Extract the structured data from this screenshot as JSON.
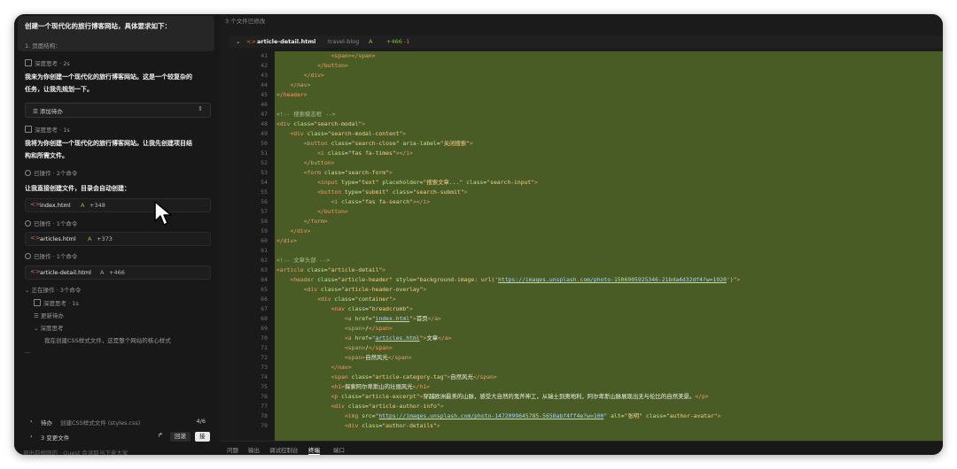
{
  "chat": {
    "prompt": "创建一个现代化的旅行博客网站，具体要求如下：",
    "prompt_sub": "1. 页面结构：",
    "thinking_1_label": "深度思考 · 2s",
    "reply_1": "我来为你创建一个现代化的旅行博客网站。这是一个较复杂的",
    "reply_1b": "任务，让我先规划一下。",
    "todo_label": "添加待办",
    "thinking_2_label": "深度思考 · 1s",
    "reply_2": "我将为你创建一个现代化的旅行博客网站。让我先创建项目结",
    "reply_2b": "构和所需文件。",
    "done_ops_1": "已操作 · 2个命令",
    "intro_create": "让我直接创建文件，目录会自动创建：",
    "files": [
      {
        "name": "index.html",
        "status": "A",
        "count": "+348"
      },
      {
        "name": "articles.html",
        "status": "A",
        "count": "+373"
      },
      {
        "name": "article-detail.html",
        "status": "A",
        "count": "+466"
      }
    ],
    "done_ops_2": "已操作 · 1个命令",
    "done_ops_3": "已操作 · 1个命令",
    "done_ops_4": "已操作 · 1个命令",
    "in_progress": "正在操作 · 3个命令",
    "sub_thinking": "深度思考 · 1s",
    "update_todo": "更新待办",
    "deep_thinking": "深度思考",
    "deep_thinking_detail": "我在创建CSS样式文件，这是整个网站的核心样式",
    "todo_row_label": "待办",
    "todo_row_detail": "创建CSS样式文件 (styles.css)",
    "todo_row_count": "4/6",
    "changes_label": "3 变更文件",
    "btn_revert": "回滚",
    "btn_accept": "接受",
    "input_hint": "退出前规则的 · Quest 会读取当下来大家"
  },
  "editor": {
    "changed_label": "3 个文件已修改",
    "file_name": "article-detail.html",
    "file_dir": "travel-blog",
    "file_status": "A",
    "file_added": "+466",
    "file_removed": "-1",
    "line_start": 41,
    "lines": [
      "                <span></span>",
      "            </button>",
      "        </div>",
      "    </nav>",
      "</header>",
      "",
      "<!-- 搜索模态框 -->",
      "<div class=\"search-modal\">",
      "    <div class=\"search-modal-content\">",
      "        <button class=\"search-close\" aria-label=\"关闭搜索\">",
      "            <i class=\"fas fa-times\"></i>",
      "        </button>",
      "        <form class=\"search-form\">",
      "            <input type=\"text\" placeholder=\"搜索文章...\" class=\"search-input\">",
      "            <button type=\"submit\" class=\"search-submit\">",
      "                <i class=\"fas fa-search\"></i>",
      "            </button>",
      "        </form>",
      "    </div>",
      "</div>",
      "",
      "<!-- 文章头部 -->",
      "<article class=\"article-detail\">",
      "    <header class=\"article-header\" style=\"background-image: url('https://images.unsplash.com/photo-1506905925346-21bda4d32df4?w=1920')\">",
      "        <div class=\"article-header-overlay\">",
      "            <div class=\"container\">",
      "                <nav class=\"breadcrumb\">",
      "                    <a href=\"index.html\">首页</a>",
      "                    <span>/</span>",
      "                    <a href=\"articles.html\">文章</a>",
      "                    <span>/</span>",
      "                    <span>自然风光</span>",
      "                </nav>",
      "                <span class=\"article-category-tag\">自然风光</span>",
      "                <h1>探索阿尔卑斯山的壮丽风光</h1>",
      "                <p class=\"article-excerpt\">穿越欧洲最美的山脉，感受大自然的鬼斧神工，从瑞士到奥地利，阿尔卑斯山脉展现出无与伦比的自然美景。</p>",
      "                <div class=\"article-author-info\">",
      "                    <img src=\"https://images.unsplash.com/photo-1472099645785-5658abf4ff4e?w=100\" alt=\"张明\" class=\"author-avatar\">",
      "                    <div class=\"author-details\">"
    ],
    "panel_tabs": [
      "问题",
      "输出",
      "调试控制台",
      "终端",
      "端口"
    ],
    "active_tab": "终端"
  }
}
